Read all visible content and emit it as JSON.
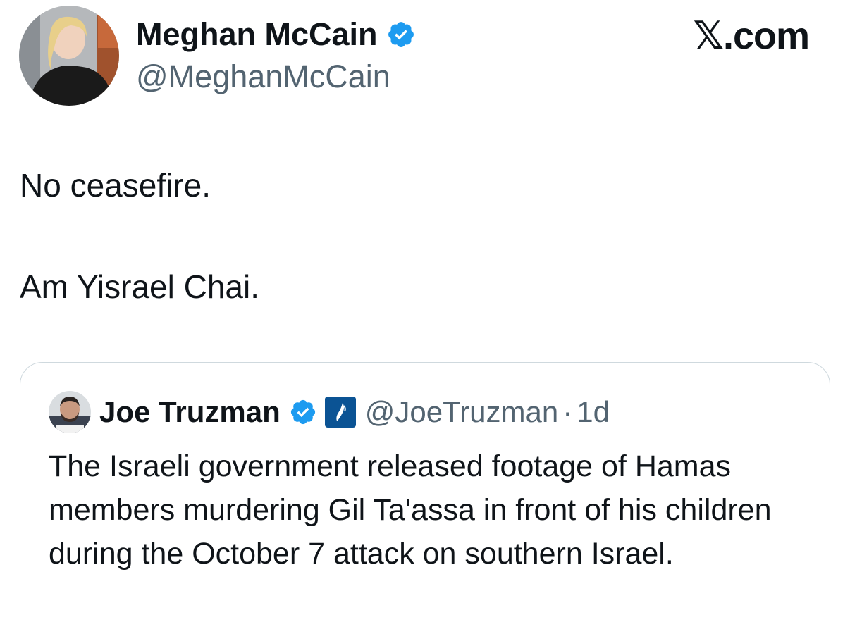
{
  "tweet": {
    "author_name": "Meghan McCain",
    "author_handle": "@MeghanMcCain",
    "verified": true,
    "site_mark": "𝕏.com",
    "text_lines": [
      "No ceasefire.",
      "Am Yisrael Chai."
    ]
  },
  "quoted_tweet": {
    "author_name": "Joe Truzman",
    "author_handle": "@JoeTruzman",
    "separator": "·",
    "timestamp": "1d",
    "verified": true,
    "org_badge_icon": "org-affiliation-icon",
    "text": "The Israeli government released footage of Hamas members murdering Gil Ta'assa in front of his children during the October 7 attack on southern Israel."
  },
  "colors": {
    "verified_blue": "#1d9bf0",
    "text_primary": "#0f1419",
    "text_secondary": "#536471",
    "border": "#cfd9de",
    "org_badge_bg": "#0b5394"
  }
}
